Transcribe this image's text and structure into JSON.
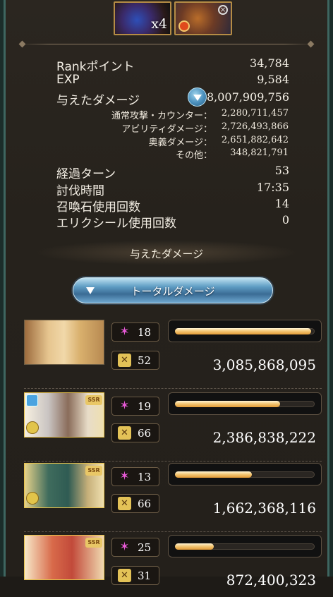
{
  "top_items": {
    "item1_count": "x4"
  },
  "stats": [
    {
      "label": "Rankポイント",
      "value": "34,784"
    },
    {
      "label": "EXP",
      "value": "9,584"
    },
    {
      "label": "与えたダメージ",
      "value": "8,007,909,756"
    }
  ],
  "damage_breakdown": [
    {
      "label": "通常攻撃・カウンター：",
      "value": "2,280,711,457"
    },
    {
      "label": "アビリティダメージ：",
      "value": "2,726,493,866"
    },
    {
      "label": "奥義ダメージ：",
      "value": "2,651,882,642"
    },
    {
      "label": "その他：",
      "value": "348,821,791"
    }
  ],
  "battle_stats": [
    {
      "label": "経過ターン",
      "value": "53"
    },
    {
      "label": "討伐時間",
      "value": "17:35"
    },
    {
      "label": "召喚石使用回数",
      "value": "14"
    },
    {
      "label": "エリクシール使用回数",
      "value": "0"
    }
  ],
  "section_title": "与えたダメージ",
  "sort_button": {
    "label": "トータルダメージ"
  },
  "characters": [
    {
      "ssr": "",
      "ougi_count": "18",
      "ability_count": "52",
      "damage": "3,085,868,095",
      "damage_ratio": 0.975
    },
    {
      "ssr": "SSR",
      "ougi_count": "19",
      "ability_count": "66",
      "damage": "2,386,838,222",
      "damage_ratio": 0.75
    },
    {
      "ssr": "SSR",
      "ougi_count": "13",
      "ability_count": "66",
      "damage": "1,662,368,116",
      "damage_ratio": 0.55
    },
    {
      "ssr": "SSR",
      "ougi_count": "25",
      "ability_count": "31",
      "damage": "872,400,323",
      "damage_ratio": 0.28
    }
  ]
}
